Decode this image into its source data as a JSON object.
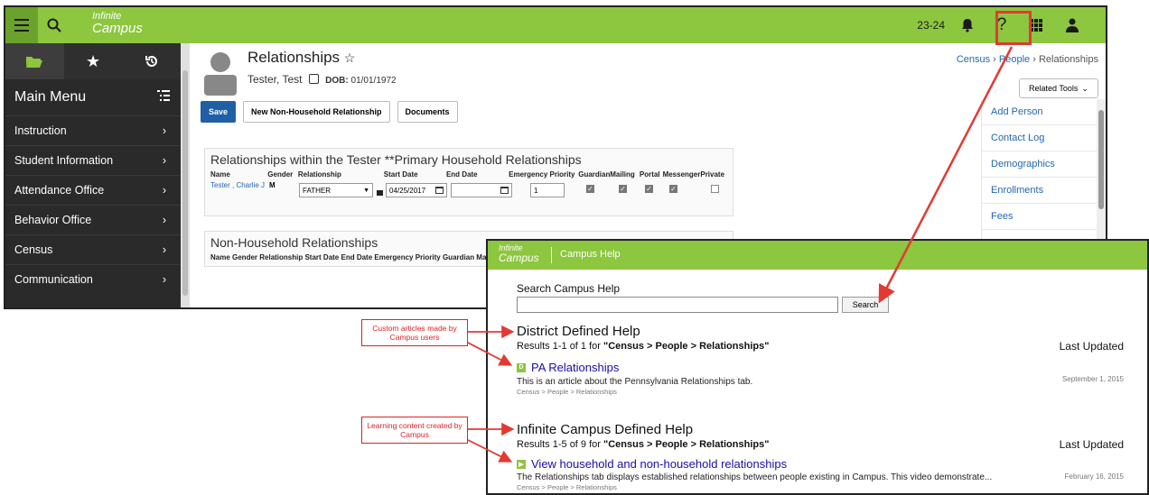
{
  "topbar": {
    "logo_top": "Infinite",
    "logo_bottom": "Campus",
    "year": "23-24"
  },
  "sidebar": {
    "menu_title": "Main Menu",
    "items": [
      {
        "label": "Instruction"
      },
      {
        "label": "Student Information"
      },
      {
        "label": "Attendance Office"
      },
      {
        "label": "Behavior Office"
      },
      {
        "label": "Census"
      },
      {
        "label": "Communication"
      }
    ]
  },
  "page": {
    "title": "Relationships",
    "person_name": "Tester, Test",
    "dob_label": "DOB:",
    "dob_value": "01/01/1972",
    "save": "Save",
    "new_rel": "New Non-Household Relationship",
    "documents": "Documents",
    "breadcrumb": {
      "census": "Census",
      "people": "People",
      "current": "Relationships"
    },
    "related_tools": "Related Tools"
  },
  "related_panel": {
    "items": [
      {
        "label": "Add Person"
      },
      {
        "label": "Contact Log"
      },
      {
        "label": "Demographics"
      },
      {
        "label": "Enrollments"
      },
      {
        "label": "Fees"
      }
    ]
  },
  "household": {
    "title": "Relationships within the Tester **Primary Household Relationships",
    "columns": [
      "Name",
      "Gender",
      "Relationship",
      "Start Date",
      "End Date",
      "Emergency Priority",
      "Guardian",
      "Mailing",
      "Portal",
      "Messenger",
      "Private"
    ],
    "row": {
      "name": "Tester , Charlie J",
      "gender": "M",
      "relationship": "FATHER",
      "start_date": "04/25/2017",
      "end_date": "",
      "priority": "1",
      "guardian": true,
      "mailing": true,
      "portal": true,
      "messenger": true,
      "private": false
    }
  },
  "nonhousehold": {
    "title": "Non-Household Relationships",
    "columns_text": "Name Gender Relationship Start Date End Date Emergency Priority Guardian Ma"
  },
  "help": {
    "logo_top": "Infinite",
    "logo_bottom": "Campus",
    "title": "Campus Help",
    "search_label": "Search Campus Help",
    "search_value": "",
    "search_button": "Search",
    "district": {
      "heading": "District Defined Help",
      "results_prefix": "Results 1-1 of 1 for ",
      "results_query": "\"Census > People > Relationships\"",
      "last_updated": "Last Updated",
      "article": {
        "badge": "D",
        "title": "PA Relationships",
        "desc": "This is an article about the Pennsylvania Relationships tab.",
        "path": "Census > People > Relationships",
        "date": "September 1, 2015"
      }
    },
    "campus": {
      "heading": "Infinite Campus Defined Help",
      "results_prefix": "Results 1-5 of 9 for ",
      "results_query": "\"Census > People > Relationships\"",
      "last_updated": "Last Updated",
      "article": {
        "title": "View household and non-household relationships",
        "desc": "The Relationships tab displays established relationships between people existing in Campus. This video demonstrate...",
        "path": "Census > People > Relationships",
        "date": "February 16, 2015"
      }
    }
  },
  "callouts": {
    "custom": "Custom articles made by Campus users",
    "learning": "Learning content created by Campus"
  },
  "colors": {
    "brand_green": "#8dc63f",
    "annotation_red": "#e23a33",
    "link_blue": "#2367b3"
  }
}
